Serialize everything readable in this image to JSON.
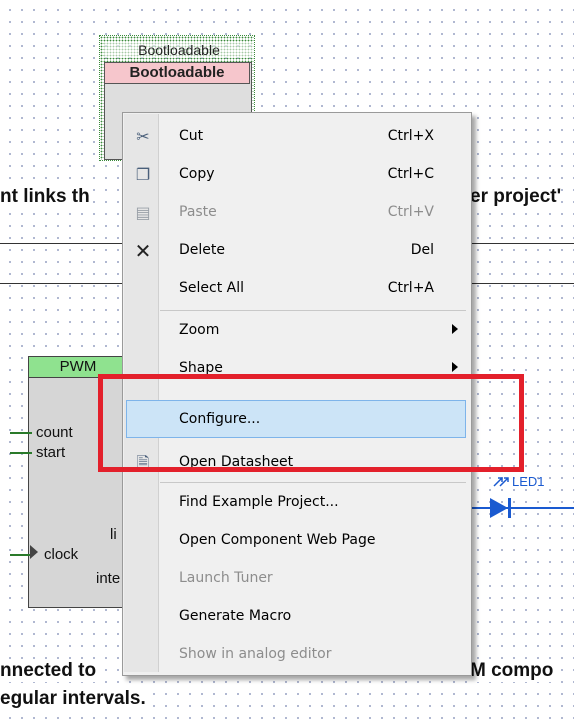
{
  "canvas": {
    "bootloadable_caption": "Bootloadable",
    "bootloadable_title": "Bootloadable",
    "text_line1_left": "nt links th",
    "text_line1_right": "er project'",
    "pwm_title": "PWM",
    "pwm_pins": {
      "count": "count",
      "start": "start",
      "clock": "clock",
      "li": "li",
      "inte": "inte"
    },
    "led_label": "LED1",
    "text_line2_left": "nnected to",
    "text_line2_right": "M compo",
    "text_line3": "egular intervals."
  },
  "context_menu": {
    "items": [
      {
        "label": "Cut",
        "shortcut": "Ctrl+X",
        "icon": "scissors-icon",
        "enabled": true
      },
      {
        "label": "Copy",
        "shortcut": "Ctrl+C",
        "icon": "copy-icon",
        "enabled": true
      },
      {
        "label": "Paste",
        "shortcut": "Ctrl+V",
        "icon": "paste-icon",
        "enabled": false
      },
      {
        "label": "Delete",
        "shortcut": "Del",
        "icon": "delete-x-icon",
        "enabled": true
      },
      {
        "label": "Select All",
        "shortcut": "Ctrl+A",
        "enabled": true
      },
      {
        "label": "Zoom",
        "submenu": true,
        "enabled": true
      },
      {
        "label": "Shape",
        "submenu": true,
        "enabled": true
      },
      {
        "label": "Configure...",
        "highlighted": true,
        "enabled": true
      },
      {
        "label": "Open Datasheet",
        "icon": "datasheet-icon",
        "enabled": true
      },
      {
        "label": "Find Example Project...",
        "enabled": true
      },
      {
        "label": "Open Component Web Page",
        "enabled": true
      },
      {
        "label": "Launch Tuner",
        "enabled": false
      },
      {
        "label": "Generate Macro",
        "enabled": true
      },
      {
        "label": "Show in analog editor",
        "enabled": false
      }
    ]
  },
  "colors": {
    "highlight_box": "#e3202b",
    "menu_hover": "#cce4f7",
    "pwm_header": "#8fe28f",
    "bootloadable_header": "#f6c6cc",
    "wire": "#1a5ad0"
  }
}
